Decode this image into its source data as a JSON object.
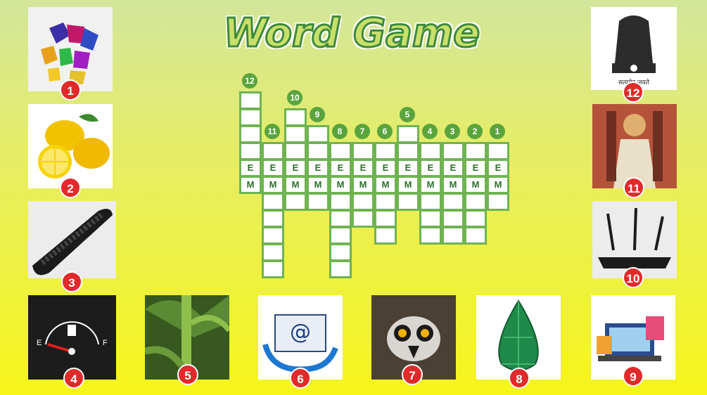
{
  "title": "Word Game",
  "clue_numbers": [
    "12",
    "11",
    "10",
    "9",
    "8",
    "7",
    "6",
    "5",
    "4",
    "3",
    "2",
    "1"
  ],
  "row_letters": {
    "e": "E",
    "m": "M"
  },
  "picture_labels": [
    "1",
    "2",
    "3",
    "4",
    "5",
    "6",
    "7",
    "8",
    "9",
    "10",
    "11",
    "12"
  ],
  "pictures": {
    "1": "gemstones",
    "2": "lemons",
    "3": "remote-control",
    "4": "fuel-gauge-empty",
    "5": "plant-stem",
    "6": "email-envelope",
    "7": "lemur",
    "8": "emerald",
    "9": "online-shopping",
    "10": "wifi-router",
    "11": "mughal-emperor-painting",
    "12": "national-emblem"
  },
  "emblem_caption": "सत्यमेव जयते",
  "fuel_gauge": {
    "empty_label": "E",
    "full_label": "F"
  },
  "colors": {
    "accent": "#6fb352",
    "badge": "#e22a2a"
  }
}
